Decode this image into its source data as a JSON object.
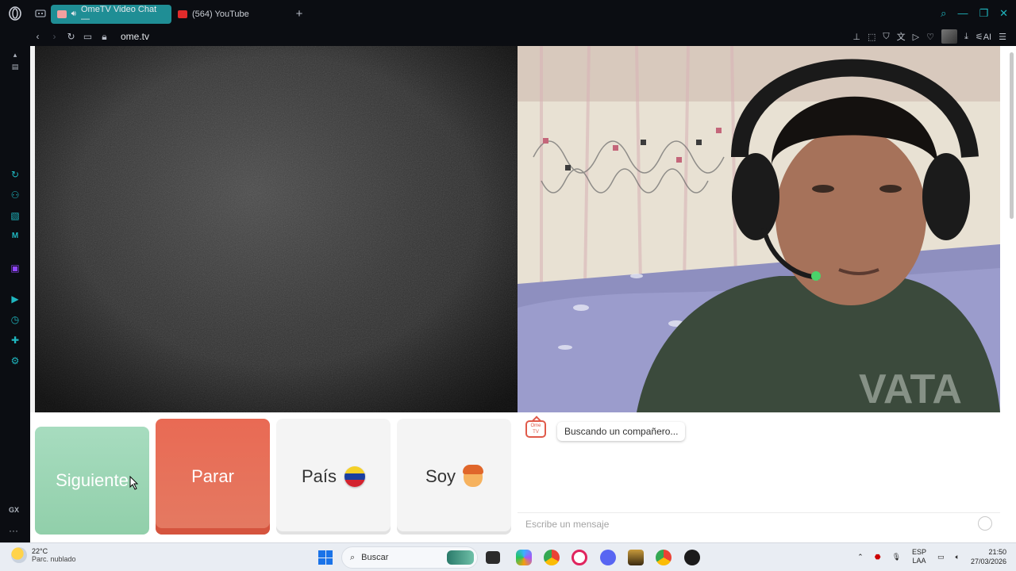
{
  "browser": {
    "tabs": [
      {
        "label": "OmeTV Video Chat —",
        "active": true
      },
      {
        "label": "(564) YouTube",
        "active": false
      }
    ],
    "url": "ome.tv",
    "ai_label": "AI"
  },
  "sidebar": {
    "gx_label": "GX",
    "more_label": "···"
  },
  "controls": {
    "next_label": "Siguiente",
    "stop_label": "Parar",
    "country_label": "País",
    "gender_label": "Soy"
  },
  "chat": {
    "logo_text": "Ome TV",
    "status_message": "Buscando un compañero...",
    "input_placeholder": "Escribe un mensaje"
  },
  "taskbar": {
    "temperature": "22°C",
    "weather": "Parc. nublado",
    "search_label": "Buscar",
    "lang_top": "ESP",
    "lang_bottom": "LAA",
    "time": "21:50",
    "date": "27/03/2026"
  },
  "colors": {
    "accent": "#1fb6bf",
    "next_button": "#a7dcbf",
    "stop_button": "#e96a54"
  }
}
